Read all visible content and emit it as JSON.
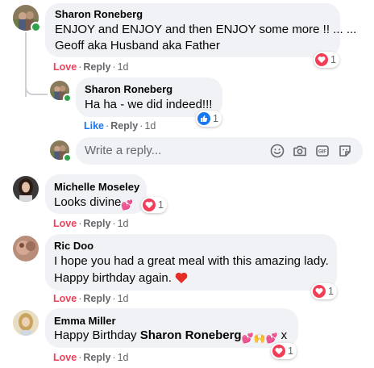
{
  "comments": [
    {
      "author": "Sharon Roneberg",
      "lines": [
        "ENJOY and ENJOY and then ENJOY some more !! ... ...",
        "Geoff aka Husband aka Father"
      ],
      "action_love": "Love",
      "action_reply": "Reply",
      "time": "1d",
      "reaction_count": "1",
      "reaction_type": "love"
    },
    {
      "author": "Sharon Roneberg",
      "lines": [
        "Ha ha - we did indeed!!!"
      ],
      "action_like": "Like",
      "action_reply": "Reply",
      "time": "1d",
      "reaction_count": "1",
      "reaction_type": "like"
    },
    {
      "author": "Michelle Moseley",
      "text": "Looks divine",
      "text_emoji": "💕",
      "action_love": "Love",
      "action_reply": "Reply",
      "time": "1d",
      "reaction_count": "1",
      "reaction_type": "love"
    },
    {
      "author": "Ric Doo",
      "lines": [
        "I hope you had a great meal with this amazing lady.",
        "Happy birthday again."
      ],
      "line2_emoji": "❤️",
      "action_love": "Love",
      "action_reply": "Reply",
      "time": "1d",
      "reaction_count": "1",
      "reaction_type": "love"
    },
    {
      "author": "Emma Miller",
      "text_prefix": "Happy Birthday ",
      "mention": "Sharon Roneberg",
      "text_emojis": "💕🙌💕",
      "text_suffix": " x",
      "action_love": "Love",
      "action_reply": "Reply",
      "time": "1d",
      "reaction_count": "1",
      "reaction_type": "love"
    }
  ],
  "reply_box": {
    "placeholder": "Write a reply...",
    "tools": [
      "emoji-icon",
      "camera-icon",
      "gif-icon",
      "sticker-icon"
    ]
  },
  "separator": "·",
  "colors": {
    "bubble": "#f0f2f5",
    "love": "#f33e58",
    "like": "#1877f2",
    "meta": "#65676b",
    "online": "#31a24c"
  }
}
